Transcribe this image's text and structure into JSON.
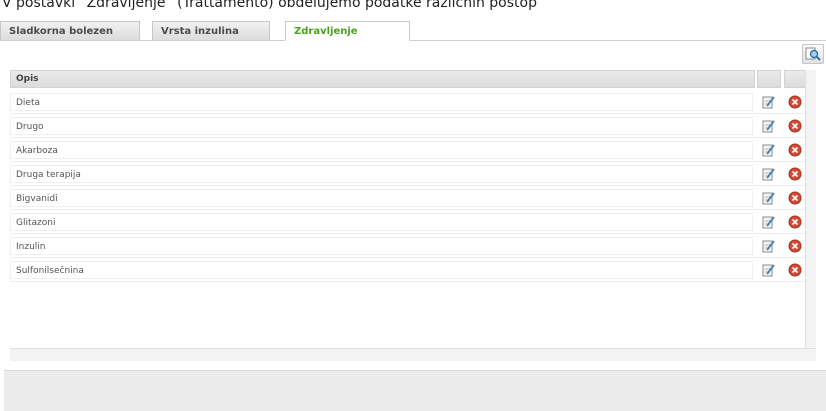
{
  "caption": "V postavki “Zdravljenje” (Trattamento) obdelujemo podatke različnih postop",
  "tabs": [
    {
      "label": "Sladkorna bolezen"
    },
    {
      "label": "Vrsta inzulina"
    },
    {
      "label": "Zdravljenje"
    }
  ],
  "grid": {
    "column_header": "Opis",
    "rows": [
      {
        "label": "Dieta"
      },
      {
        "label": "Drugo"
      },
      {
        "label": "Akarboza"
      },
      {
        "label": "Druga terapija"
      },
      {
        "label": "Bigvanidi"
      },
      {
        "label": "Glitazoni"
      },
      {
        "label": "Inzulin"
      },
      {
        "label": "Sulfonilsečnina"
      }
    ]
  },
  "icons": {
    "toolbar": "search-icon",
    "edit": "edit-icon",
    "delete": "delete-icon"
  },
  "colors": {
    "active_tab_text": "#4aa11f",
    "delete_icon": "#d44a3a"
  }
}
